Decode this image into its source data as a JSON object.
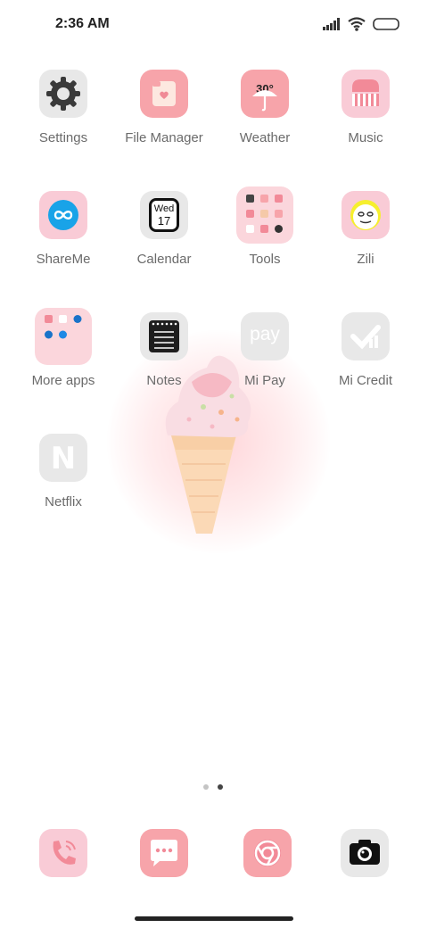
{
  "status": {
    "time": "2:36 AM",
    "icons": [
      "signal-icon",
      "wifi-icon",
      "battery-icon"
    ]
  },
  "apps": [
    {
      "label": "Settings",
      "icon": "gear-icon"
    },
    {
      "label": "File Manager",
      "icon": "folder-icon"
    },
    {
      "label": "Weather",
      "icon": "umbrella-icon",
      "temp": "30°"
    },
    {
      "label": "Music",
      "icon": "music-icon"
    },
    {
      "label": "ShareMe",
      "icon": "infinity-icon"
    },
    {
      "label": "Calendar",
      "icon": "calendar-icon",
      "day": "Wed",
      "date": "17"
    },
    {
      "label": "Tools",
      "icon": "folder-grid-icon"
    },
    {
      "label": "Zili",
      "icon": "face-icon"
    },
    {
      "label": "More apps",
      "icon": "folder-grid-icon"
    },
    {
      "label": "Notes",
      "icon": "notes-icon"
    },
    {
      "label": "Mi Pay",
      "icon": "pay-icon",
      "glyph": "pay"
    },
    {
      "label": "Mi Credit",
      "icon": "credit-icon"
    },
    {
      "label": "Netflix",
      "icon": "netflix-icon",
      "glyph": "N"
    }
  ],
  "pages": {
    "count": 2,
    "active": 2
  },
  "dock": [
    {
      "icon": "phone-icon"
    },
    {
      "icon": "messages-icon"
    },
    {
      "icon": "browser-icon"
    },
    {
      "icon": "camera-icon"
    }
  ],
  "colors": {
    "pink": "#f7a4aa",
    "light_pink": "#f9cbd6",
    "gray_tile": "#e8e8e8",
    "label": "#6b6b6b"
  }
}
